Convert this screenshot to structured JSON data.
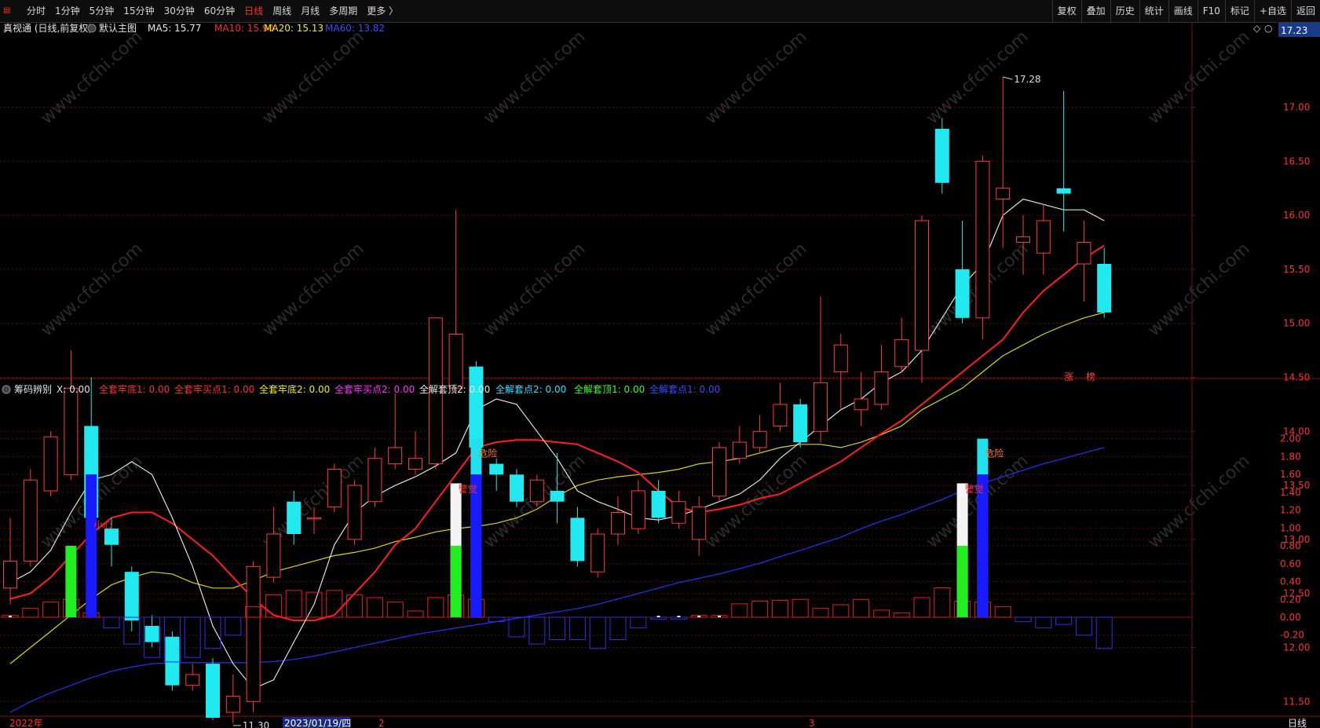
{
  "toolbar": {
    "periods": [
      "分时",
      "1分钟",
      "5分钟",
      "15分钟",
      "30分钟",
      "60分钟",
      "日线",
      "周线",
      "月线",
      "多周期",
      "更多 〉"
    ],
    "active_period": "日线",
    "right_buttons": [
      "复权",
      "叠加",
      "历史",
      "统计",
      "画线",
      "F10",
      "标记",
      "+自选",
      "返回"
    ]
  },
  "main_panel": {
    "title": "真视通 (日线,前复权)",
    "default_label": "默认主图",
    "legend": [
      {
        "text": "MA5: 15.77",
        "color": "#e8e8e8"
      },
      {
        "text": "MA10: 15.90",
        "color": "#ff2a2a"
      },
      {
        "text": "MA20: 15.13",
        "color": "#f0f000"
      },
      {
        "text": "MA60: 13.82",
        "color": "#3050ff"
      }
    ],
    "current_price": "17.23",
    "high_label": "17.28",
    "low_label": "11.30",
    "tags": [
      "涨",
      "榜"
    ],
    "y_axis": [
      "17.00",
      "16.50",
      "16.00",
      "15.50",
      "15.00",
      "14.50",
      "14.00",
      "13.50",
      "13.00",
      "12.50",
      "12.00",
      "11.50"
    ]
  },
  "sub_panel": {
    "title": "筹码辨别",
    "x_label": "X: 0.00",
    "legend": [
      {
        "text": "全套牢底1: 0.00",
        "color": "#ff3030"
      },
      {
        "text": "全套牢买点1: 0.00",
        "color": "#ff3030"
      },
      {
        "text": "全套牢底2: 0.00",
        "color": "#f0f000"
      },
      {
        "text": "全套牢买点2: 0.00",
        "color": "#ff30ff"
      },
      {
        "text": "全解套顶2: 0.00",
        "color": "#e8e8e8"
      },
      {
        "text": "全解套点2: 0.00",
        "color": "#30e0ff"
      },
      {
        "text": "全解套顶1: 0.00",
        "color": "#30ff30"
      },
      {
        "text": "全解套点1: 0.00",
        "color": "#3050ff"
      }
    ],
    "y_axis": [
      "2.00",
      "1.80",
      "1.60",
      "1.40",
      "1.20",
      "1.00",
      "0.80",
      "0.60",
      "0.40",
      "0.20",
      "0.00",
      "-0.20"
    ],
    "annotations": [
      "小心",
      "警觉",
      "危险"
    ]
  },
  "bottom_axis": {
    "labels": [
      "2022年",
      "2023/01/19/四",
      "2",
      "3"
    ],
    "period": "日线"
  },
  "watermark": "www.cfchi.com",
  "chart_data": {
    "type": "candlestick",
    "candles": [
      {
        "o": 12.55,
        "c": 12.8,
        "h": 13.2,
        "l": 12.4
      },
      {
        "o": 12.8,
        "c": 13.55,
        "h": 13.65,
        "l": 12.75
      },
      {
        "o": 13.45,
        "c": 13.95,
        "h": 14.0,
        "l": 13.4
      },
      {
        "o": 13.6,
        "c": 14.4,
        "h": 14.75,
        "l": 13.55
      },
      {
        "o": 14.05,
        "c": 13.2,
        "h": 14.5,
        "l": 13.1
      },
      {
        "o": 13.1,
        "c": 12.95,
        "h": 13.2,
        "l": 12.75
      },
      {
        "o": 12.7,
        "c": 12.25,
        "h": 12.75,
        "l": 12.15
      },
      {
        "o": 12.2,
        "c": 12.05,
        "h": 12.3,
        "l": 12.0
      },
      {
        "o": 12.1,
        "c": 11.65,
        "h": 12.15,
        "l": 11.6
      },
      {
        "o": 11.65,
        "c": 11.75,
        "h": 11.85,
        "l": 11.6
      },
      {
        "o": 11.85,
        "c": 11.35,
        "h": 11.9,
        "l": 11.33
      },
      {
        "o": 11.4,
        "c": 11.55,
        "h": 11.75,
        "l": 11.3
      },
      {
        "o": 11.5,
        "c": 12.75,
        "h": 12.8,
        "l": 11.4
      },
      {
        "o": 12.65,
        "c": 13.05,
        "h": 13.3,
        "l": 12.6
      },
      {
        "o": 13.35,
        "c": 13.05,
        "h": 13.45,
        "l": 12.95
      },
      {
        "o": 13.2,
        "c": 13.2,
        "h": 13.3,
        "l": 13.05
      },
      {
        "o": 13.3,
        "c": 13.65,
        "h": 13.7,
        "l": 13.25
      },
      {
        "o": 13.0,
        "c": 13.5,
        "h": 13.55,
        "l": 12.95
      },
      {
        "o": 13.35,
        "c": 13.75,
        "h": 13.85,
        "l": 13.3
      },
      {
        "o": 13.7,
        "c": 13.85,
        "h": 14.35,
        "l": 13.65
      },
      {
        "o": 13.65,
        "c": 13.75,
        "h": 14.0,
        "l": 13.6
      },
      {
        "o": 13.7,
        "c": 15.05,
        "h": 15.05,
        "l": 13.65
      },
      {
        "o": 14.4,
        "c": 14.9,
        "h": 16.05,
        "l": 14.35
      },
      {
        "o": 14.6,
        "c": 13.85,
        "h": 14.65,
        "l": 13.8
      },
      {
        "o": 13.7,
        "c": 13.6,
        "h": 13.75,
        "l": 13.45
      },
      {
        "o": 13.6,
        "c": 13.35,
        "h": 13.65,
        "l": 13.3
      },
      {
        "o": 13.35,
        "c": 13.55,
        "h": 13.6,
        "l": 13.3
      },
      {
        "o": 13.45,
        "c": 13.35,
        "h": 13.8,
        "l": 13.15
      },
      {
        "o": 13.2,
        "c": 12.8,
        "h": 13.3,
        "l": 12.75
      },
      {
        "o": 12.7,
        "c": 13.05,
        "h": 13.1,
        "l": 12.65
      },
      {
        "o": 13.05,
        "c": 13.25,
        "h": 13.4,
        "l": 12.95
      },
      {
        "o": 13.1,
        "c": 13.45,
        "h": 13.55,
        "l": 13.05
      },
      {
        "o": 13.45,
        "c": 13.2,
        "h": 13.55,
        "l": 13.15
      },
      {
        "o": 13.15,
        "c": 13.35,
        "h": 13.45,
        "l": 13.1
      },
      {
        "o": 13.0,
        "c": 13.3,
        "h": 13.4,
        "l": 12.85
      },
      {
        "o": 13.4,
        "c": 13.85,
        "h": 13.9,
        "l": 13.35
      },
      {
        "o": 13.75,
        "c": 13.9,
        "h": 14.05,
        "l": 13.7
      },
      {
        "o": 13.85,
        "c": 14.0,
        "h": 14.15,
        "l": 13.8
      },
      {
        "o": 14.05,
        "c": 14.25,
        "h": 14.45,
        "l": 14.0
      },
      {
        "o": 14.25,
        "c": 13.9,
        "h": 14.3,
        "l": 13.85
      },
      {
        "o": 14.0,
        "c": 14.45,
        "h": 15.25,
        "l": 13.9
      },
      {
        "o": 14.55,
        "c": 14.8,
        "h": 14.9,
        "l": 14.2
      },
      {
        "o": 14.2,
        "c": 14.3,
        "h": 14.55,
        "l": 14.05
      },
      {
        "o": 14.25,
        "c": 14.55,
        "h": 14.8,
        "l": 14.2
      },
      {
        "o": 14.6,
        "c": 14.85,
        "h": 15.05,
        "l": 14.55
      },
      {
        "o": 14.75,
        "c": 15.95,
        "h": 16.0,
        "l": 14.45
      },
      {
        "o": 16.8,
        "c": 16.3,
        "h": 16.9,
        "l": 16.2
      },
      {
        "o": 15.5,
        "c": 15.05,
        "h": 15.95,
        "l": 15.0
      },
      {
        "o": 15.05,
        "c": 16.5,
        "h": 16.55,
        "l": 14.85
      },
      {
        "o": 16.15,
        "c": 16.25,
        "h": 17.28,
        "l": 15.7
      },
      {
        "o": 15.75,
        "c": 15.8,
        "h": 16.0,
        "l": 15.45
      },
      {
        "o": 15.65,
        "c": 15.95,
        "h": 16.1,
        "l": 15.45
      },
      {
        "o": 16.25,
        "c": 16.2,
        "h": 17.15,
        "l": 15.85
      },
      {
        "o": 15.55,
        "c": 15.75,
        "h": 15.95,
        "l": 15.2
      },
      {
        "o": 15.55,
        "c": 15.1,
        "h": 15.7,
        "l": 15.05
      }
    ],
    "ma5": [
      12.6,
      12.7,
      12.9,
      13.25,
      13.55,
      13.6,
      13.72,
      13.6,
      13.2,
      12.75,
      12.2,
      11.85,
      11.62,
      11.7,
      12.05,
      12.4,
      12.95,
      13.25,
      13.4,
      13.5,
      13.58,
      13.68,
      13.8,
      14.2,
      14.3,
      14.25,
      14.0,
      13.75,
      13.45,
      13.35,
      13.28,
      13.2,
      13.18,
      13.22,
      13.28,
      13.35,
      13.42,
      13.55,
      13.75,
      13.9,
      14.05,
      14.2,
      14.3,
      14.45,
      14.55,
      14.75,
      15.05,
      15.35,
      15.55,
      16.0,
      16.15,
      16.1,
      16.05,
      16.05,
      15.95
    ],
    "ma10": [
      12.45,
      12.5,
      12.65,
      12.85,
      13.05,
      13.2,
      13.25,
      13.25,
      13.15,
      13.0,
      12.85,
      12.65,
      12.45,
      12.3,
      12.25,
      12.25,
      12.3,
      12.5,
      12.7,
      12.95,
      13.1,
      13.35,
      13.6,
      13.85,
      13.9,
      13.92,
      13.92,
      13.9,
      13.88,
      13.8,
      13.72,
      13.62,
      13.45,
      13.3,
      13.25,
      13.28,
      13.32,
      13.38,
      13.42,
      13.52,
      13.62,
      13.72,
      13.85,
      13.98,
      14.1,
      14.25,
      14.4,
      14.55,
      14.7,
      14.85,
      15.1,
      15.3,
      15.45,
      15.6,
      15.72
    ],
    "ma20": [
      11.85,
      12.0,
      12.15,
      12.3,
      12.45,
      12.58,
      12.65,
      12.7,
      12.68,
      12.6,
      12.55,
      12.55,
      12.62,
      12.7,
      12.75,
      12.8,
      12.85,
      12.88,
      12.92,
      12.98,
      13.02,
      13.07,
      13.1,
      13.12,
      13.15,
      13.2,
      13.28,
      13.4,
      13.5,
      13.55,
      13.58,
      13.6,
      13.62,
      13.65,
      13.7,
      13.72,
      13.75,
      13.8,
      13.85,
      13.88,
      13.88,
      13.85,
      13.9,
      13.97,
      14.05,
      14.2,
      14.3,
      14.4,
      14.55,
      14.7,
      14.8,
      14.9,
      14.98,
      15.05,
      15.1
    ],
    "ma60": [
      11.4,
      11.5,
      11.58,
      11.65,
      11.72,
      11.78,
      11.82,
      11.85,
      11.86,
      11.86,
      11.86,
      11.86,
      11.86,
      11.87,
      11.89,
      11.92,
      11.96,
      12.0,
      12.04,
      12.08,
      12.12,
      12.15,
      12.18,
      12.21,
      12.24,
      12.27,
      12.3,
      12.33,
      12.36,
      12.4,
      12.45,
      12.5,
      12.55,
      12.6,
      12.64,
      12.68,
      12.73,
      12.78,
      12.84,
      12.9,
      12.96,
      13.02,
      13.1,
      13.17,
      13.23,
      13.3,
      13.37,
      13.45,
      13.52,
      13.58,
      13.64,
      13.7,
      13.75,
      13.8,
      13.85
    ],
    "indicator": [
      0.02,
      0.1,
      0.17,
      0.2,
      0.05,
      -0.12,
      -0.3,
      -0.45,
      -0.5,
      -0.45,
      -0.35,
      -0.2,
      0.12,
      0.25,
      0.3,
      0.28,
      0.3,
      0.25,
      0.22,
      0.17,
      0.07,
      0.22,
      0.25,
      0.2,
      -0.05,
      -0.22,
      -0.3,
      -0.25,
      -0.25,
      -0.35,
      -0.25,
      -0.12,
      -0.02,
      -0.02,
      0.02,
      0.02,
      0.15,
      0.18,
      0.19,
      0.2,
      0.1,
      0.14,
      0.2,
      0.08,
      0.05,
      0.22,
      0.33,
      0.18,
      0.17,
      0.12,
      -0.05,
      -0.12,
      -0.08,
      -0.2,
      -0.35
    ],
    "signals": [
      {
        "i": 3,
        "green": 0.8
      },
      {
        "i": 4,
        "blue": 1.6,
        "note": "小心"
      },
      {
        "i": 22,
        "green": 0.8,
        "white": 1.5,
        "note": "警觉"
      },
      {
        "i": 23,
        "blue": 1.6,
        "cyan": 2.0,
        "note": "危险"
      },
      {
        "i": 47,
        "green": 0.8,
        "white": 1.5,
        "note": "警觉"
      },
      {
        "i": 48,
        "blue": 1.6,
        "cyan": 2.0,
        "note": "危险"
      }
    ]
  }
}
